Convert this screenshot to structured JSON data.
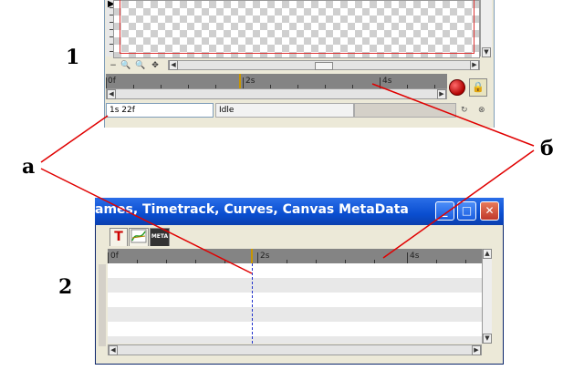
{
  "labels": {
    "panel1": "1",
    "panel2": "2",
    "a": "a",
    "b": "б"
  },
  "top_panel": {
    "timebar": {
      "marks": [
        "0f",
        "2s",
        "4s"
      ]
    },
    "time_field": "1s 22f",
    "status": "Idle"
  },
  "bottom_panel": {
    "title": "ames, Timetrack, Curves, Canvas MetaData",
    "tabs": [
      "T",
      "curves-icon",
      "META"
    ],
    "timebar": {
      "marks": [
        "0f",
        "2s",
        "4s"
      ]
    }
  },
  "colors": {
    "annotation_line": "#e00000",
    "titlebar": "#0a4ed0",
    "timebar": "#848484",
    "time_cursor": "#c89600",
    "playhead_dashed": "#2233cc"
  }
}
